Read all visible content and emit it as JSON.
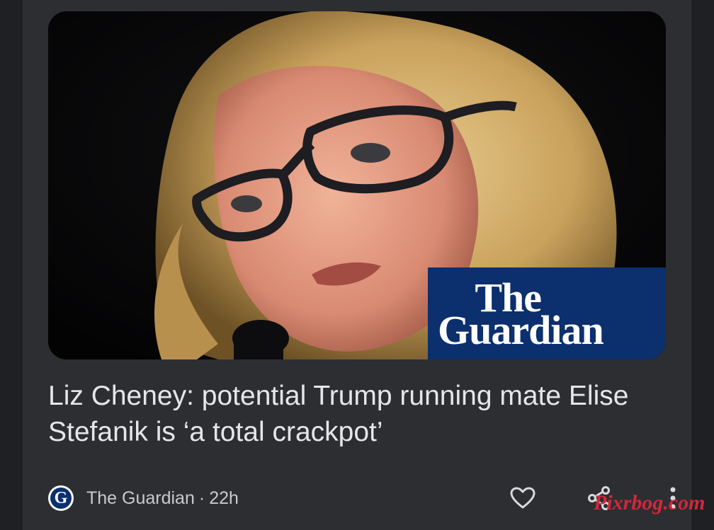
{
  "article": {
    "image_overlay_logo": {
      "line1": "The",
      "line2": "Guardian"
    },
    "headline": "Liz Cheney: potential Trump running mate Elise Stefanik is ‘a total crackpot’",
    "source_logo_letter": "G",
    "source": "The Guardian",
    "separator": "·",
    "age": "22h"
  },
  "actions": {
    "like_icon": "heart-icon",
    "share_icon": "share-icon",
    "more_icon": "more-vert-icon"
  },
  "watermark": "Pixrbog.com",
  "colors": {
    "page_background": "#1f2023",
    "card_background": "#2d2e32",
    "guardian_blue": "#0c2f6e",
    "headline_text": "#e6e6e8",
    "watermark_red": "#d4263a"
  }
}
